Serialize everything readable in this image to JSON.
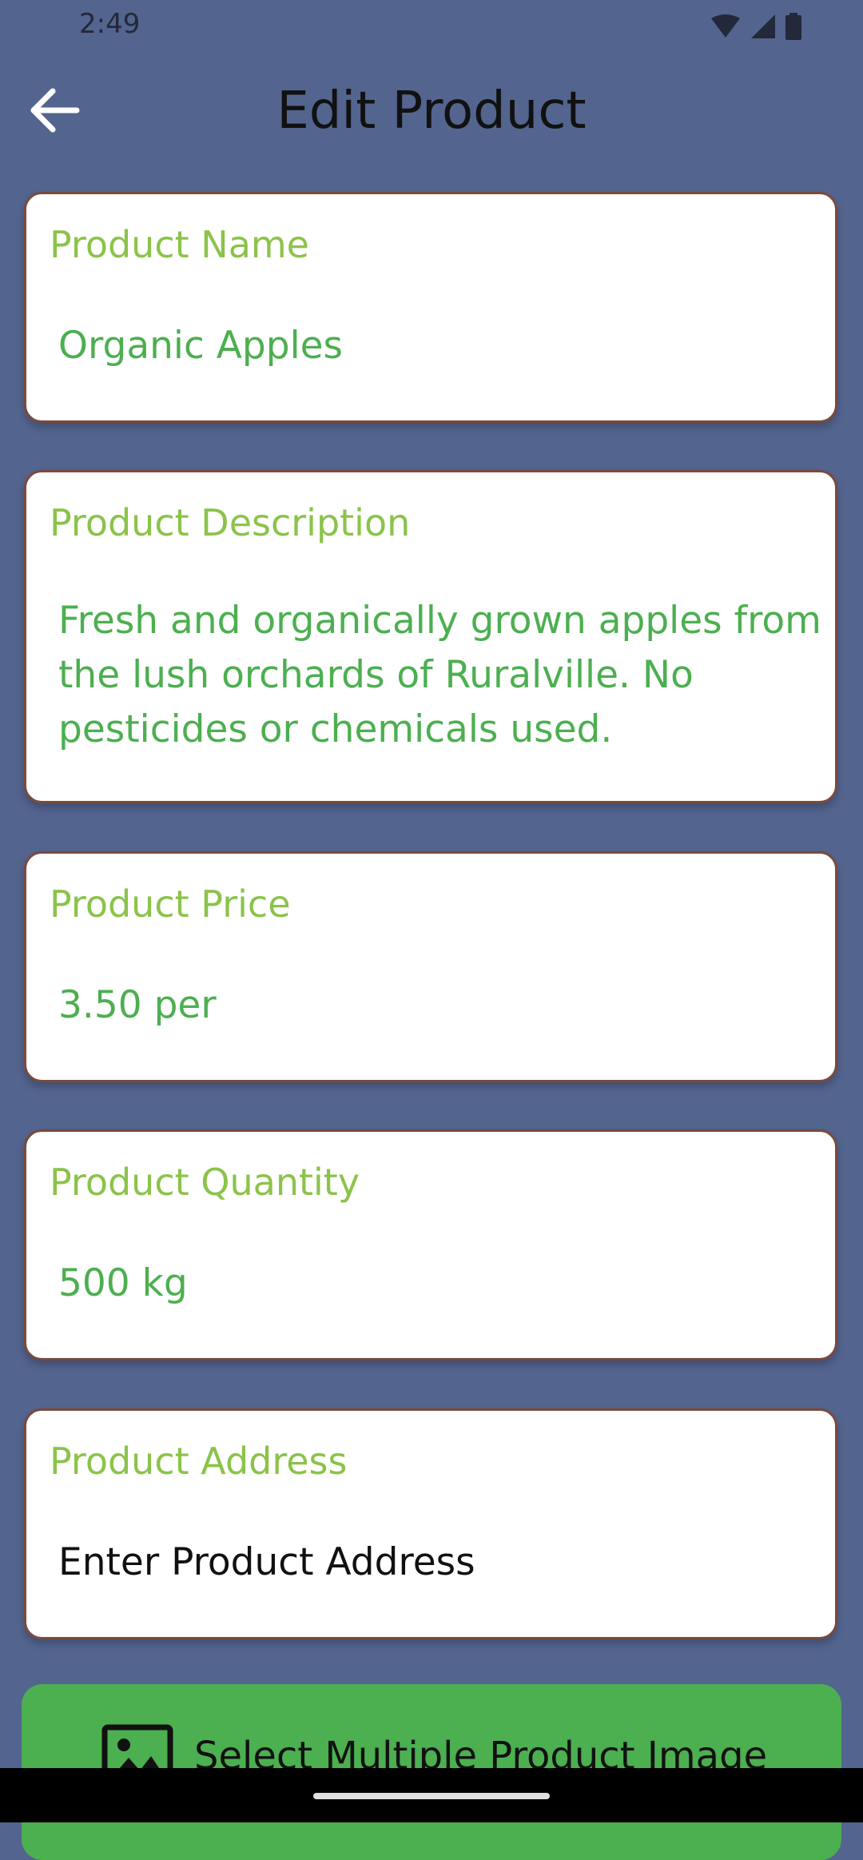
{
  "status_bar": {
    "time": "2:49",
    "icons": [
      "wifi-icon",
      "cell-signal-icon",
      "battery-icon"
    ]
  },
  "app_bar": {
    "title": "Edit Product",
    "back_icon": "arrow-back-icon"
  },
  "fields": {
    "name": {
      "label": "Product Name",
      "value": "Organic Apples"
    },
    "description": {
      "label": "Product Description",
      "value": "Fresh and organically grown apples from the lush orchards of Ruralville. No pesticides or chemicals used."
    },
    "price": {
      "label": "Product Price",
      "value": "3.50 per"
    },
    "quantity": {
      "label": "Product Quantity",
      "value": "500 kg"
    },
    "address": {
      "label": "Product Address",
      "placeholder": "Enter Product Address"
    }
  },
  "select_images": {
    "label": "Select Multiple Product Image",
    "icon": "image-icon"
  },
  "colors": {
    "background": "#53648f",
    "label_green": "#8bc34a",
    "value_green": "#4caf50",
    "button_green": "#4caf50",
    "card_border": "#7a4a3c"
  }
}
